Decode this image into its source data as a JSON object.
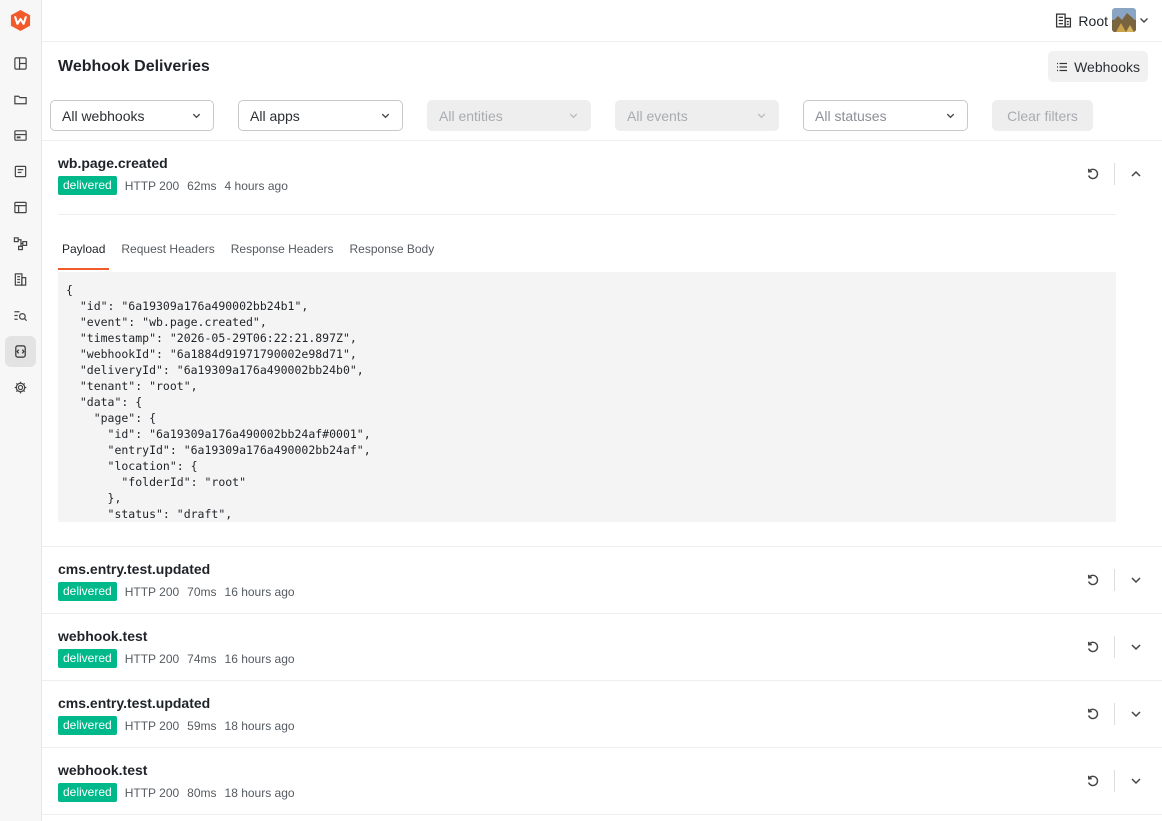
{
  "topbar": {
    "tenant_label": "Root"
  },
  "header": {
    "title": "Webhook Deliveries",
    "webhooks_button": "Webhooks"
  },
  "filters": {
    "webhooks": "All webhooks",
    "apps": "All apps",
    "entities": "All entities",
    "events": "All events",
    "statuses": "All statuses",
    "clear": "Clear filters"
  },
  "colors": {
    "brand": "#f15a2b",
    "delivered": "#00b98b"
  },
  "icons": {
    "sidebar": [
      "dashboard-icon",
      "folder-icon",
      "storage-icon",
      "forms-icon",
      "table-icon",
      "workflow-icon",
      "tenants-icon",
      "search-logs-icon",
      "webhooks-icon",
      "settings-icon"
    ]
  },
  "expanded": {
    "tabs": [
      "Payload",
      "Request Headers",
      "Response Headers",
      "Response Body"
    ],
    "payload": "{\n  \"id\": \"6a19309a176a490002bb24b1\",\n  \"event\": \"wb.page.created\",\n  \"timestamp\": \"2026-05-29T06:22:21.897Z\",\n  \"webhookId\": \"6a1884d91971790002e98d71\",\n  \"deliveryId\": \"6a19309a176a490002bb24b0\",\n  \"tenant\": \"root\",\n  \"data\": {\n    \"page\": {\n      \"id\": \"6a19309a176a490002bb24af#0001\",\n      \"entryId\": \"6a19309a176a490002bb24af\",\n      \"location\": {\n        \"folderId\": \"root\"\n      },\n      \"status\": \"draft\","
  },
  "deliveries": [
    {
      "event": "wb.page.created",
      "status": "delivered",
      "http": "HTTP 200",
      "duration": "62ms",
      "time": "4 hours ago"
    },
    {
      "event": "cms.entry.test.updated",
      "status": "delivered",
      "http": "HTTP 200",
      "duration": "70ms",
      "time": "16 hours ago"
    },
    {
      "event": "webhook.test",
      "status": "delivered",
      "http": "HTTP 200",
      "duration": "74ms",
      "time": "16 hours ago"
    },
    {
      "event": "cms.entry.test.updated",
      "status": "delivered",
      "http": "HTTP 200",
      "duration": "59ms",
      "time": "18 hours ago"
    },
    {
      "event": "webhook.test",
      "status": "delivered",
      "http": "HTTP 200",
      "duration": "80ms",
      "time": "18 hours ago"
    }
  ]
}
